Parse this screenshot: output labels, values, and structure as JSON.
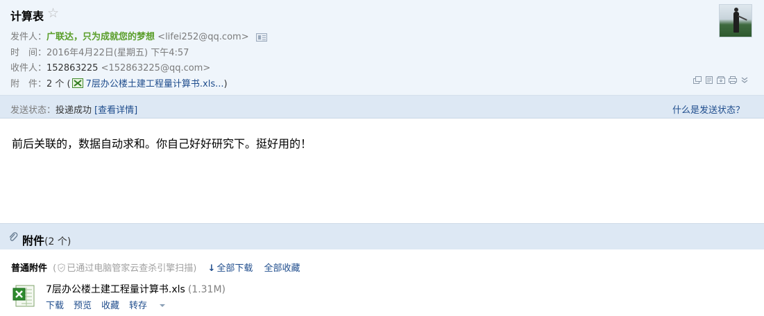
{
  "header": {
    "subject": "计算表",
    "star_icon": "star-outline-icon",
    "sender_label": "发件人：",
    "sender_name": "广联达，只为成就您的梦想",
    "sender_email": "<lifei252@qq.com>",
    "time_label": "时　间：",
    "time_value": "2016年4月22日(星期五) 下午4:57",
    "recipient_label": "收件人：",
    "recipient_name": "152863225",
    "recipient_email": "<152863225@qq.com>",
    "attachment_label": "附　件：",
    "attachment_count": "2 个 (",
    "attachment_link": "7层办公楼土建工程量计算书.xls...",
    "attachment_close": ")"
  },
  "toolbar_icons": [
    "new-window-icon",
    "read-mode-icon",
    "archive-icon",
    "print-icon",
    "expand-more-icon"
  ],
  "status_bar": {
    "label": "发送状态：",
    "value": "投递成功",
    "detail_link": "[查看详情]",
    "help_link": "什么是发送状态？"
  },
  "body": {
    "text": "前后关联的，数据自动求和。你自己好好研究下。挺好用的！"
  },
  "attachments": {
    "title": "附件",
    "count": "(2 个)",
    "kind": "普通附件",
    "scan_open": "(",
    "scan_text": "已通过电脑管家云查杀引擎扫描",
    "scan_close": ")",
    "download_all": "全部下载",
    "save_all": "全部收藏",
    "file": {
      "name": "7层办公楼土建工程量计算书.xls",
      "size": "(1.31M)",
      "actions": {
        "download": "下载",
        "preview": "预览",
        "save": "收藏",
        "forward": "转存"
      }
    }
  },
  "colors": {
    "header_bg": "#eff5fb",
    "bar_bg": "#dde8f4",
    "link": "#1e4c8c",
    "sender": "#5a9e2a"
  }
}
